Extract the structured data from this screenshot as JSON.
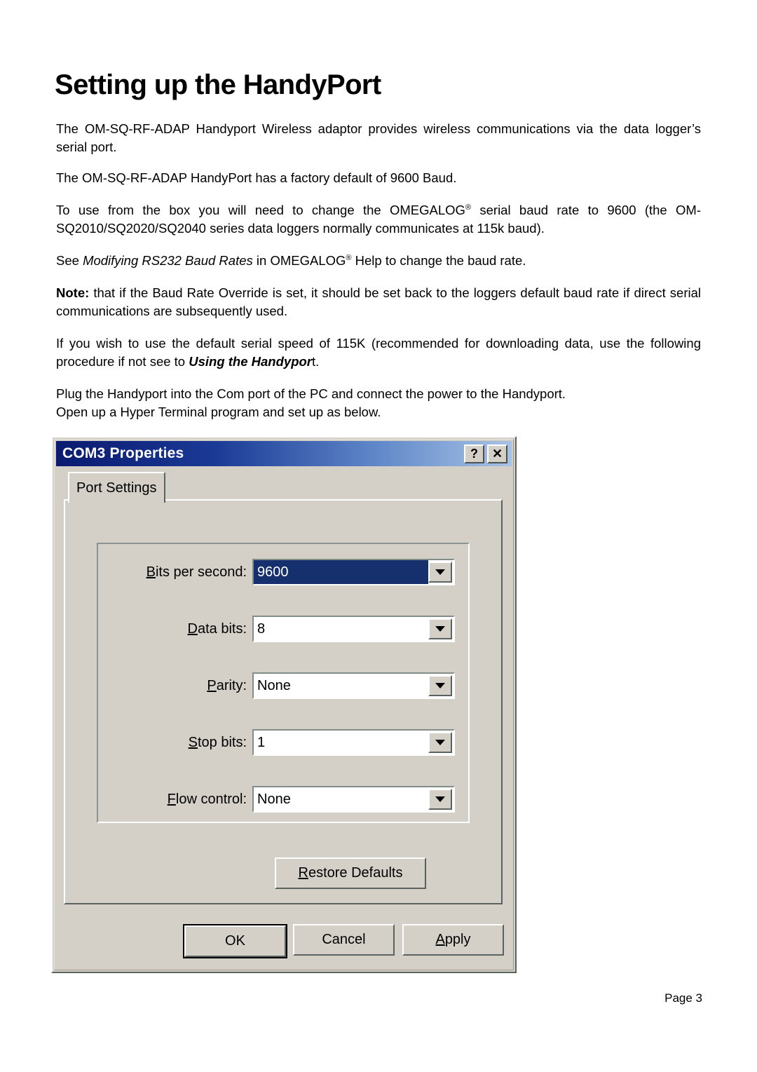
{
  "document": {
    "title": "Setting up the HandyPort",
    "paragraphs": {
      "p1_a": "The OM-SQ-RF-ADAP Handyport Wireless adaptor provides wireless communications via the data logger’s serial port.",
      "p2_a": "The OM-SQ-RF-ADAP HandyPort has a factory default of 9600 Baud.",
      "p3_a": "To use from the box you will need to change the OMEGALOG",
      "p3_reg": "®",
      "p3_b": " serial baud rate to 9600 (the OM-SQ2010/SQ2020/SQ2040 series data loggers normally communicates at 115k baud).",
      "p4_a": "See ",
      "p4_italic": "Modifying RS232 Baud Rates",
      "p4_b": " in OMEGALOG",
      "p4_reg": "®",
      "p4_c": " Help to change the baud rate.",
      "p5_note": "Note:",
      "p5_a": " that if the Baud Rate Override is set, it should be set back to the loggers default baud rate if direct serial communications are subsequently used.",
      "p6_a": "If you wish to use the default serial speed of 115K (recommended for downloading data, use the following procedure if not see to ",
      "p6_bolditalic": "Using the Handypor",
      "p6_b": "t.",
      "p7_line1": "Plug the Handyport into the Com port of the PC and connect the power to the Handyport.",
      "p7_line2": "Open up a Hyper Terminal program and set up as below."
    },
    "footer": "Page 3"
  },
  "dialog": {
    "title": "COM3 Properties",
    "titlebar_buttons": {
      "help": "?",
      "close": "✕"
    },
    "tab": {
      "label": "Port Settings"
    },
    "fields": [
      {
        "label_accel": "B",
        "label_rest": "its per second:",
        "value": "9600",
        "selected": true,
        "name": "bits-per-second"
      },
      {
        "label_accel": "D",
        "label_rest": "ata bits:",
        "value": "8",
        "selected": false,
        "name": "data-bits"
      },
      {
        "label_accel": "P",
        "label_rest": "arity:",
        "value": "None",
        "selected": false,
        "name": "parity"
      },
      {
        "label_accel": "S",
        "label_rest": "top bits:",
        "value": "1",
        "selected": false,
        "name": "stop-bits"
      },
      {
        "label_accel": "F",
        "label_rest": "low control:",
        "value": "None",
        "selected": false,
        "name": "flow-control"
      }
    ],
    "buttons": {
      "restore_accel": "R",
      "restore_rest": "estore Defaults",
      "ok": "OK",
      "cancel": "Cancel",
      "apply_accel": "A",
      "apply_rest": "pply"
    }
  },
  "colors": {
    "dialog_face": "#d4d0c8",
    "titlebar_start": "#0a1a70",
    "titlebar_end": "#a8c2e4",
    "selection": "#16306e"
  }
}
